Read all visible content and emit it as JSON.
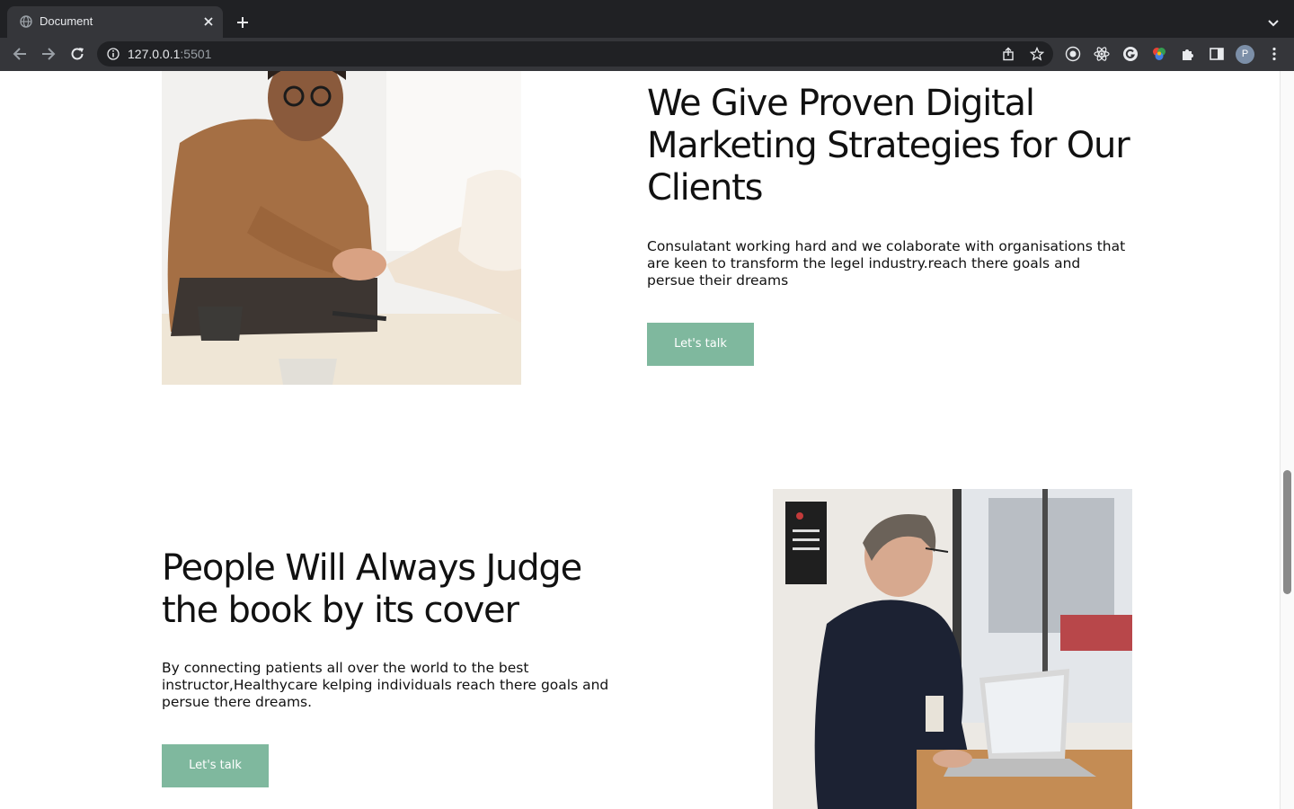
{
  "browser": {
    "tab_title": "Document",
    "url_host": "127.0.0.1",
    "url_port": ":5501",
    "profile_initial": "P"
  },
  "section1": {
    "heading": "We Give Proven Digital Marketing Strategies for Our Clients",
    "paragraph": "Consulatant working hard and we colaborate with organisations that are keen to transform the legel industry.reach there goals and persue their dreams",
    "button_label": "Let's talk"
  },
  "section2": {
    "heading": "People Will Always Judge the book by its cover",
    "paragraph": "By connecting patients all over the world to the best instructor,Healthycare kelping individuals reach there goals and persue there dreams.",
    "button_label": "Let's talk"
  },
  "colors": {
    "button_bg": "#7fb89e",
    "chrome_dark": "#202124",
    "chrome_toolbar": "#35363a"
  }
}
